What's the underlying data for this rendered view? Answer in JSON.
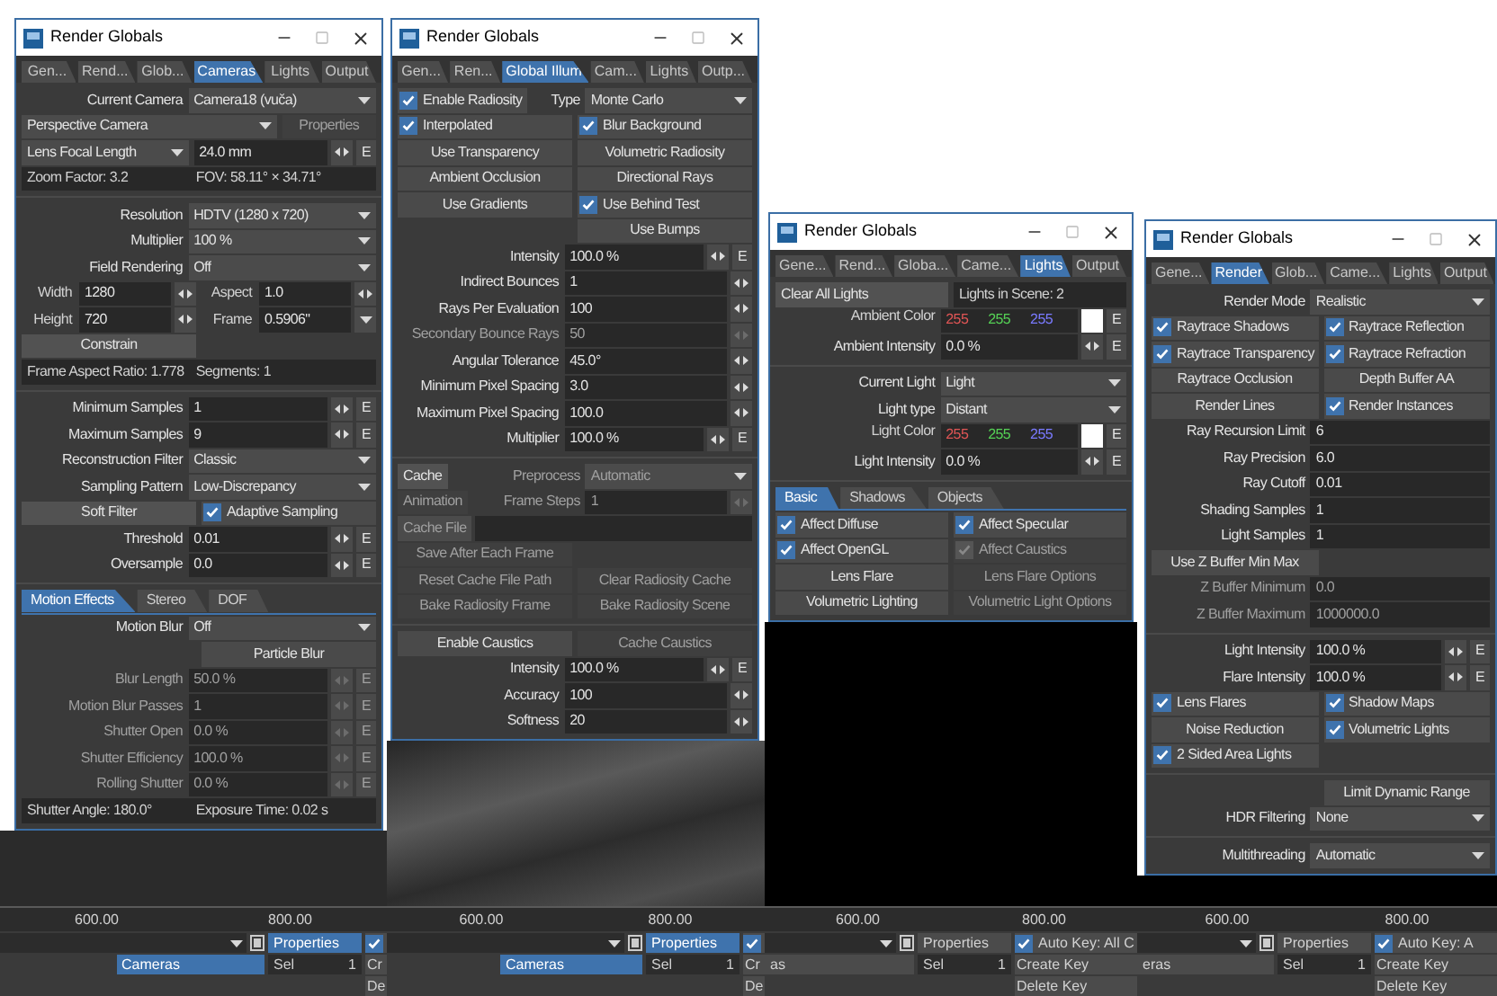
{
  "windows": [
    {
      "title": "Render Globals",
      "tabs": [
        {
          "label": "Gen...",
          "selected": false
        },
        {
          "label": "Rend...",
          "selected": false
        },
        {
          "label": "Glob...",
          "selected": false
        },
        {
          "label": "Cameras",
          "selected": true
        },
        {
          "label": "Lights",
          "selected": false
        },
        {
          "label": "Output",
          "selected": false
        }
      ],
      "rows": [
        {
          "kind": "select",
          "label": "Current Camera",
          "value": "Camera18 (vuča)"
        },
        {
          "kind": "select_button",
          "value": "Perspective Camera",
          "button": {
            "label": "Properties",
            "disabled": true
          }
        },
        {
          "kind": "select_field",
          "select": "Lens Focal Length",
          "value": "24.0 mm",
          "spin": true,
          "env": "E"
        },
        {
          "kind": "info",
          "texts": [
            "Zoom Factor: 3.2",
            "FOV: 58.11° × 34.71°"
          ]
        },
        {
          "kind": "divider"
        },
        {
          "kind": "select",
          "label": "Resolution",
          "value": "HDTV (1280 x 720)"
        },
        {
          "kind": "select",
          "label": "Multiplier",
          "value": "100 %"
        },
        {
          "kind": "select",
          "label": "Field Rendering",
          "value": "Off"
        },
        {
          "kind": "pair",
          "items": [
            {
              "label": "Width",
              "value": "1280",
              "spin": true
            },
            {
              "label": "Aspect",
              "value": "1.0",
              "spin": true
            }
          ]
        },
        {
          "kind": "pair",
          "items": [
            {
              "label": "Height",
              "value": "720",
              "spin": true
            },
            {
              "label": "Frame",
              "value": "0.5906\"",
              "dropdown": true
            }
          ]
        },
        {
          "kind": "toggles",
          "items": [
            {
              "kind": "button",
              "label": "Constrain",
              "disabled": false
            }
          ]
        },
        {
          "kind": "info",
          "texts": [
            "Frame Aspect Ratio: 1.778",
            "Segments: 1"
          ]
        },
        {
          "kind": "divider"
        },
        {
          "kind": "field",
          "label": "Minimum Samples",
          "value": "1",
          "spin": true,
          "env": "E",
          "disabled": false
        },
        {
          "kind": "field",
          "label": "Maximum Samples",
          "value": "9",
          "spin": true,
          "env": "E",
          "disabled": false
        },
        {
          "kind": "select",
          "label": "Reconstruction Filter",
          "value": "Classic"
        },
        {
          "kind": "select",
          "label": "Sampling Pattern",
          "value": "Low-Discrepancy"
        },
        {
          "kind": "toggles",
          "items": [
            {
              "kind": "button",
              "label": "Soft Filter",
              "disabled": false
            },
            {
              "kind": "toggle",
              "label": "Adaptive Sampling",
              "checked": true,
              "disabled": false
            }
          ]
        },
        {
          "kind": "field",
          "label": "Threshold",
          "value": "0.01",
          "spin": true,
          "env": "E",
          "disabled": false
        },
        {
          "kind": "field",
          "label": "Oversample",
          "value": "0.0",
          "spin": true,
          "env": "E",
          "disabled": false
        },
        {
          "kind": "divider"
        },
        {
          "kind": "subtabs",
          "tabs": [
            {
              "label": "Motion Effects",
              "selected": true
            },
            {
              "label": "Stereo",
              "selected": false
            },
            {
              "label": "DOF",
              "selected": false
            }
          ]
        },
        {
          "kind": "select",
          "label": "Motion Blur",
          "value": "Off"
        },
        {
          "kind": "toggles_right",
          "items": [
            {
              "kind": "toggle",
              "label": "Particle Blur",
              "checked": false,
              "disabled": false
            }
          ]
        },
        {
          "kind": "field",
          "label": "Blur Length",
          "value": "50.0 %",
          "spin": true,
          "env": "E",
          "disabled": true
        },
        {
          "kind": "field",
          "label": "Motion Blur Passes",
          "value": "1",
          "spin": true,
          "env": "E",
          "disabled": true
        },
        {
          "kind": "field",
          "label": "Shutter Open",
          "value": "0.0 %",
          "spin": true,
          "env": "E",
          "disabled": true
        },
        {
          "kind": "field",
          "label": "Shutter Efficiency",
          "value": "100.0 %",
          "spin": true,
          "env": "E",
          "disabled": true
        },
        {
          "kind": "field",
          "label": "Rolling Shutter",
          "value": "0.0 %",
          "spin": true,
          "env": "E",
          "disabled": true
        },
        {
          "kind": "info",
          "texts": [
            "Shutter Angle: 180.0°",
            "Exposure Time: 0.02 s"
          ]
        }
      ]
    },
    {
      "title": "Render Globals",
      "tabs": [
        {
          "label": "Gen...",
          "selected": false
        },
        {
          "label": "Ren...",
          "selected": false
        },
        {
          "label": "Global Illum",
          "selected": true
        },
        {
          "label": "Cam...",
          "selected": false
        },
        {
          "label": "Lights",
          "selected": false
        },
        {
          "label": "Outp...",
          "selected": false
        }
      ],
      "rows": [
        {
          "kind": "select",
          "lead": {
            "kind": "toggle",
            "label": "Enable Radiosity",
            "checked": true,
            "disabled": false
          },
          "label": "Type",
          "value": "Monte Carlo"
        },
        {
          "kind": "toggles",
          "items": [
            {
              "kind": "toggle",
              "label": "Interpolated",
              "checked": true,
              "disabled": false
            },
            {
              "kind": "toggle",
              "label": "Blur Background",
              "checked": true,
              "disabled": false
            }
          ]
        },
        {
          "kind": "toggles",
          "items": [
            {
              "kind": "toggle",
              "label": "Use Transparency",
              "checked": false,
              "disabled": false
            },
            {
              "kind": "toggle",
              "label": "Volumetric Radiosity",
              "checked": false,
              "disabled": false
            }
          ]
        },
        {
          "kind": "toggles",
          "items": [
            {
              "kind": "toggle",
              "label": "Ambient Occlusion",
              "checked": false,
              "disabled": false
            },
            {
              "kind": "toggle",
              "label": "Directional Rays",
              "checked": false,
              "disabled": false
            }
          ]
        },
        {
          "kind": "toggles",
          "items": [
            {
              "kind": "toggle",
              "label": "Use Gradients",
              "checked": false,
              "disabled": false
            },
            {
              "kind": "toggle",
              "label": "Use Behind Test",
              "checked": true,
              "disabled": false
            }
          ]
        },
        {
          "kind": "toggles_right",
          "items": [
            {
              "kind": "toggle",
              "label": "Use Bumps",
              "checked": false,
              "disabled": false
            }
          ]
        },
        {
          "kind": "field",
          "label": "Intensity",
          "value": "100.0 %",
          "spin": true,
          "env": "E",
          "disabled": false
        },
        {
          "kind": "field",
          "label": "Indirect Bounces",
          "value": "1",
          "spin": true,
          "disabled": false
        },
        {
          "kind": "field",
          "label": "Rays Per Evaluation",
          "value": "100",
          "spin": true,
          "disabled": false
        },
        {
          "kind": "field",
          "label": "Secondary Bounce Rays",
          "value": "50",
          "spin": true,
          "disabled": true
        },
        {
          "kind": "field",
          "label": "Angular Tolerance",
          "value": "45.0°",
          "spin": true,
          "disabled": false
        },
        {
          "kind": "field",
          "label": "Minimum Pixel Spacing",
          "value": "3.0",
          "spin": true,
          "disabled": false
        },
        {
          "kind": "field",
          "label": "Maximum Pixel Spacing",
          "value": "100.0",
          "spin": true,
          "disabled": false
        },
        {
          "kind": "field",
          "label": "Multiplier",
          "value": "100.0 %",
          "spin": true,
          "env": "E",
          "disabled": false
        },
        {
          "kind": "divider"
        },
        {
          "kind": "select",
          "lead": {
            "kind": "button",
            "label": "Cache",
            "disabled": false
          },
          "label": "Preprocess",
          "value": "Automatic",
          "disabled": true
        },
        {
          "kind": "field",
          "lead": {
            "kind": "button",
            "label": "Animation",
            "disabled": true
          },
          "label": "Frame Steps",
          "value": "1",
          "spin": true,
          "disabled": true
        },
        {
          "kind": "file",
          "label": "Cache File",
          "disabled": true
        },
        {
          "kind": "toggles",
          "items": [
            {
              "kind": "button",
              "label": "Save After Each Frame",
              "disabled": true
            }
          ]
        },
        {
          "kind": "toggles",
          "items": [
            {
              "kind": "button",
              "label": "Reset Cache File Path",
              "disabled": true
            },
            {
              "kind": "button",
              "label": "Clear Radiosity Cache",
              "disabled": true
            }
          ]
        },
        {
          "kind": "toggles",
          "items": [
            {
              "kind": "button",
              "label": "Bake Radiosity Frame",
              "disabled": true
            },
            {
              "kind": "button",
              "label": "Bake Radiosity Scene",
              "disabled": true
            }
          ]
        },
        {
          "kind": "divider"
        },
        {
          "kind": "toggles",
          "items": [
            {
              "kind": "toggle",
              "label": "Enable Caustics",
              "checked": false,
              "disabled": false
            },
            {
              "kind": "button",
              "label": "Cache Caustics",
              "disabled": true
            }
          ]
        },
        {
          "kind": "field",
          "label": "Intensity",
          "value": "100.0 %",
          "spin": true,
          "env": "E",
          "disabled": false
        },
        {
          "kind": "field",
          "label": "Accuracy",
          "value": "100",
          "spin": true,
          "disabled": false
        },
        {
          "kind": "field",
          "label": "Softness",
          "value": "20",
          "spin": true,
          "disabled": false
        }
      ]
    },
    {
      "title": "Render Globals",
      "tabs": [
        {
          "label": "Gene...",
          "selected": false
        },
        {
          "label": "Rend...",
          "selected": false
        },
        {
          "label": "Globa...",
          "selected": false
        },
        {
          "label": "Came...",
          "selected": false
        },
        {
          "label": "Lights",
          "selected": true
        },
        {
          "label": "Output",
          "selected": false
        }
      ],
      "rows": [
        {
          "kind": "button_info",
          "button": {
            "label": "Clear All Lights",
            "disabled": false
          },
          "text": "Lights in Scene: 2"
        },
        {
          "kind": "color",
          "label": "Ambient Color",
          "values": [
            {
              "text": "255",
              "color": "#e05555"
            },
            {
              "text": "255",
              "color": "#55d055"
            },
            {
              "text": "255",
              "color": "#7a7aff"
            }
          ],
          "env": "E"
        },
        {
          "kind": "field",
          "label": "Ambient Intensity",
          "value": "0.0 %",
          "spin": true,
          "env": "E",
          "disabled": false
        },
        {
          "kind": "divider"
        },
        {
          "kind": "select",
          "label": "Current Light",
          "value": "Light"
        },
        {
          "kind": "select",
          "label": "Light type",
          "value": "Distant"
        },
        {
          "kind": "color",
          "label": "Light Color",
          "values": [
            {
              "text": "255",
              "color": "#e05555"
            },
            {
              "text": "255",
              "color": "#55d055"
            },
            {
              "text": "255",
              "color": "#7a7aff"
            }
          ],
          "env": "E"
        },
        {
          "kind": "field",
          "label": "Light Intensity",
          "value": "0.0 %",
          "spin": true,
          "env": "E",
          "disabled": false
        },
        {
          "kind": "divider"
        },
        {
          "kind": "subtabs",
          "tabs": [
            {
              "label": "Basic",
              "selected": true
            },
            {
              "label": "Shadows",
              "selected": false
            },
            {
              "label": "Objects",
              "selected": false
            }
          ]
        },
        {
          "kind": "toggles",
          "items": [
            {
              "kind": "toggle",
              "label": "Affect Diffuse",
              "checked": true,
              "disabled": false
            },
            {
              "kind": "toggle",
              "label": "Affect Specular",
              "checked": true,
              "disabled": false
            }
          ]
        },
        {
          "kind": "toggles",
          "items": [
            {
              "kind": "toggle",
              "label": "Affect OpenGL",
              "checked": true,
              "disabled": false
            },
            {
              "kind": "toggle",
              "label": "Affect Caustics",
              "checked": true,
              "disabled": true
            }
          ]
        },
        {
          "kind": "toggles",
          "items": [
            {
              "kind": "toggle",
              "label": "Lens Flare",
              "checked": false,
              "disabled": false
            },
            {
              "kind": "button",
              "label": "Lens Flare Options",
              "disabled": true
            }
          ]
        },
        {
          "kind": "toggles",
          "items": [
            {
              "kind": "toggle",
              "label": "Volumetric Lighting",
              "checked": false,
              "disabled": false
            },
            {
              "kind": "button",
              "label": "Volumetric Light Options",
              "disabled": true
            }
          ]
        }
      ]
    },
    {
      "title": "Render Globals",
      "tabs": [
        {
          "label": "Gene...",
          "selected": false
        },
        {
          "label": "Render",
          "selected": true
        },
        {
          "label": "Glob...",
          "selected": false
        },
        {
          "label": "Came...",
          "selected": false
        },
        {
          "label": "Lights",
          "selected": false
        },
        {
          "label": "Output",
          "selected": false
        }
      ],
      "rows": [
        {
          "kind": "select",
          "label": "Render Mode",
          "value": "Realistic"
        },
        {
          "kind": "toggles",
          "items": [
            {
              "kind": "toggle",
              "label": "Raytrace Shadows",
              "checked": true,
              "disabled": false
            },
            {
              "kind": "toggle",
              "label": "Raytrace Reflection",
              "checked": true,
              "disabled": false
            }
          ]
        },
        {
          "kind": "toggles",
          "items": [
            {
              "kind": "toggle",
              "label": "Raytrace Transparency",
              "checked": true,
              "disabled": false
            },
            {
              "kind": "toggle",
              "label": "Raytrace Refraction",
              "checked": true,
              "disabled": false
            }
          ]
        },
        {
          "kind": "toggles",
          "items": [
            {
              "kind": "toggle",
              "label": "Raytrace Occlusion",
              "checked": false,
              "disabled": false
            },
            {
              "kind": "toggle",
              "label": "Depth Buffer AA",
              "checked": false,
              "disabled": false
            }
          ]
        },
        {
          "kind": "toggles",
          "items": [
            {
              "kind": "toggle",
              "label": "Render Lines",
              "checked": false,
              "disabled": false
            },
            {
              "kind": "toggle",
              "label": "Render Instances",
              "checked": true,
              "disabled": false
            }
          ]
        },
        {
          "kind": "field",
          "label": "Ray Recursion Limit",
          "value": "6",
          "disabled": false
        },
        {
          "kind": "field",
          "label": "Ray Precision",
          "value": "6.0",
          "disabled": false
        },
        {
          "kind": "field",
          "label": "Ray Cutoff",
          "value": "0.01",
          "disabled": false
        },
        {
          "kind": "field",
          "label": "Shading Samples",
          "value": "1",
          "disabled": false
        },
        {
          "kind": "field",
          "label": "Light Samples",
          "value": "1",
          "disabled": false
        },
        {
          "kind": "toggles",
          "items": [
            {
              "kind": "toggle",
              "label": "Use Z Buffer Min Max",
              "checked": false,
              "disabled": false
            }
          ]
        },
        {
          "kind": "field",
          "label": "Z Buffer Minimum",
          "value": "0.0",
          "disabled": true
        },
        {
          "kind": "field",
          "label": "Z Buffer Maximum",
          "value": "1000000.0",
          "disabled": true
        },
        {
          "kind": "divider"
        },
        {
          "kind": "field",
          "label": "Light Intensity",
          "value": "100.0 %",
          "spin": true,
          "env": "E",
          "disabled": false
        },
        {
          "kind": "field",
          "label": "Flare Intensity",
          "value": "100.0 %",
          "spin": true,
          "env": "E",
          "disabled": false
        },
        {
          "kind": "toggles",
          "items": [
            {
              "kind": "toggle",
              "label": "Lens Flares",
              "checked": true,
              "disabled": false
            },
            {
              "kind": "toggle",
              "label": "Shadow Maps",
              "checked": true,
              "disabled": false
            }
          ]
        },
        {
          "kind": "toggles",
          "items": [
            {
              "kind": "toggle",
              "label": "Noise Reduction",
              "checked": false,
              "disabled": false
            },
            {
              "kind": "toggle",
              "label": "Volumetric Lights",
              "checked": true,
              "disabled": false
            }
          ]
        },
        {
          "kind": "toggles",
          "items": [
            {
              "kind": "toggle",
              "label": "2 Sided Area Lights",
              "checked": true,
              "disabled": false
            }
          ]
        },
        {
          "kind": "divider"
        },
        {
          "kind": "toggles_right",
          "items": [
            {
              "kind": "toggle",
              "label": "Limit Dynamic Range",
              "checked": false,
              "disabled": false
            }
          ]
        },
        {
          "kind": "select",
          "label": "HDR Filtering",
          "value": "None"
        },
        {
          "kind": "divider"
        },
        {
          "kind": "select",
          "label": "Multithreading",
          "value": "Automatic"
        }
      ]
    }
  ],
  "timelines": [
    {
      "ticks": [
        "600.00",
        "800.00"
      ],
      "properties": {
        "label": "Properties",
        "selected": true
      },
      "auto_key": {
        "checked": true
      },
      "mode": {
        "label": "Cameras",
        "selected": true
      },
      "sel": {
        "label": "Sel",
        "value": "1"
      },
      "keys": [
        "Cr",
        "De"
      ]
    },
    {
      "ticks": [
        "600.00",
        "800.00"
      ],
      "properties": {
        "label": "Properties",
        "selected": true
      },
      "auto_key": {
        "checked": true
      },
      "mode": {
        "label": "Cameras",
        "selected": true
      },
      "sel": {
        "label": "Sel",
        "value": "1"
      },
      "keys": [
        "Cr",
        "De"
      ]
    },
    {
      "ticks": [
        "600.00",
        "800.00"
      ],
      "properties": {
        "label": "Properties",
        "selected": false
      },
      "auto_key": {
        "checked": true,
        "label": "Auto Key: All C"
      },
      "mode": {
        "label": "as",
        "selected": false
      },
      "sel": {
        "label": "Sel",
        "value": "1"
      },
      "keys": [
        "Create Key",
        "Delete Key"
      ]
    },
    {
      "ticks": [
        "600.00",
        "800.00"
      ],
      "properties": {
        "label": "Properties",
        "selected": false
      },
      "auto_key": {
        "checked": true,
        "label": "Auto Key: A"
      },
      "mode": {
        "label": "eras",
        "selected": false
      },
      "sel": {
        "label": "Sel",
        "value": "1"
      },
      "keys": [
        "Create Key",
        "Delete Key"
      ]
    }
  ]
}
